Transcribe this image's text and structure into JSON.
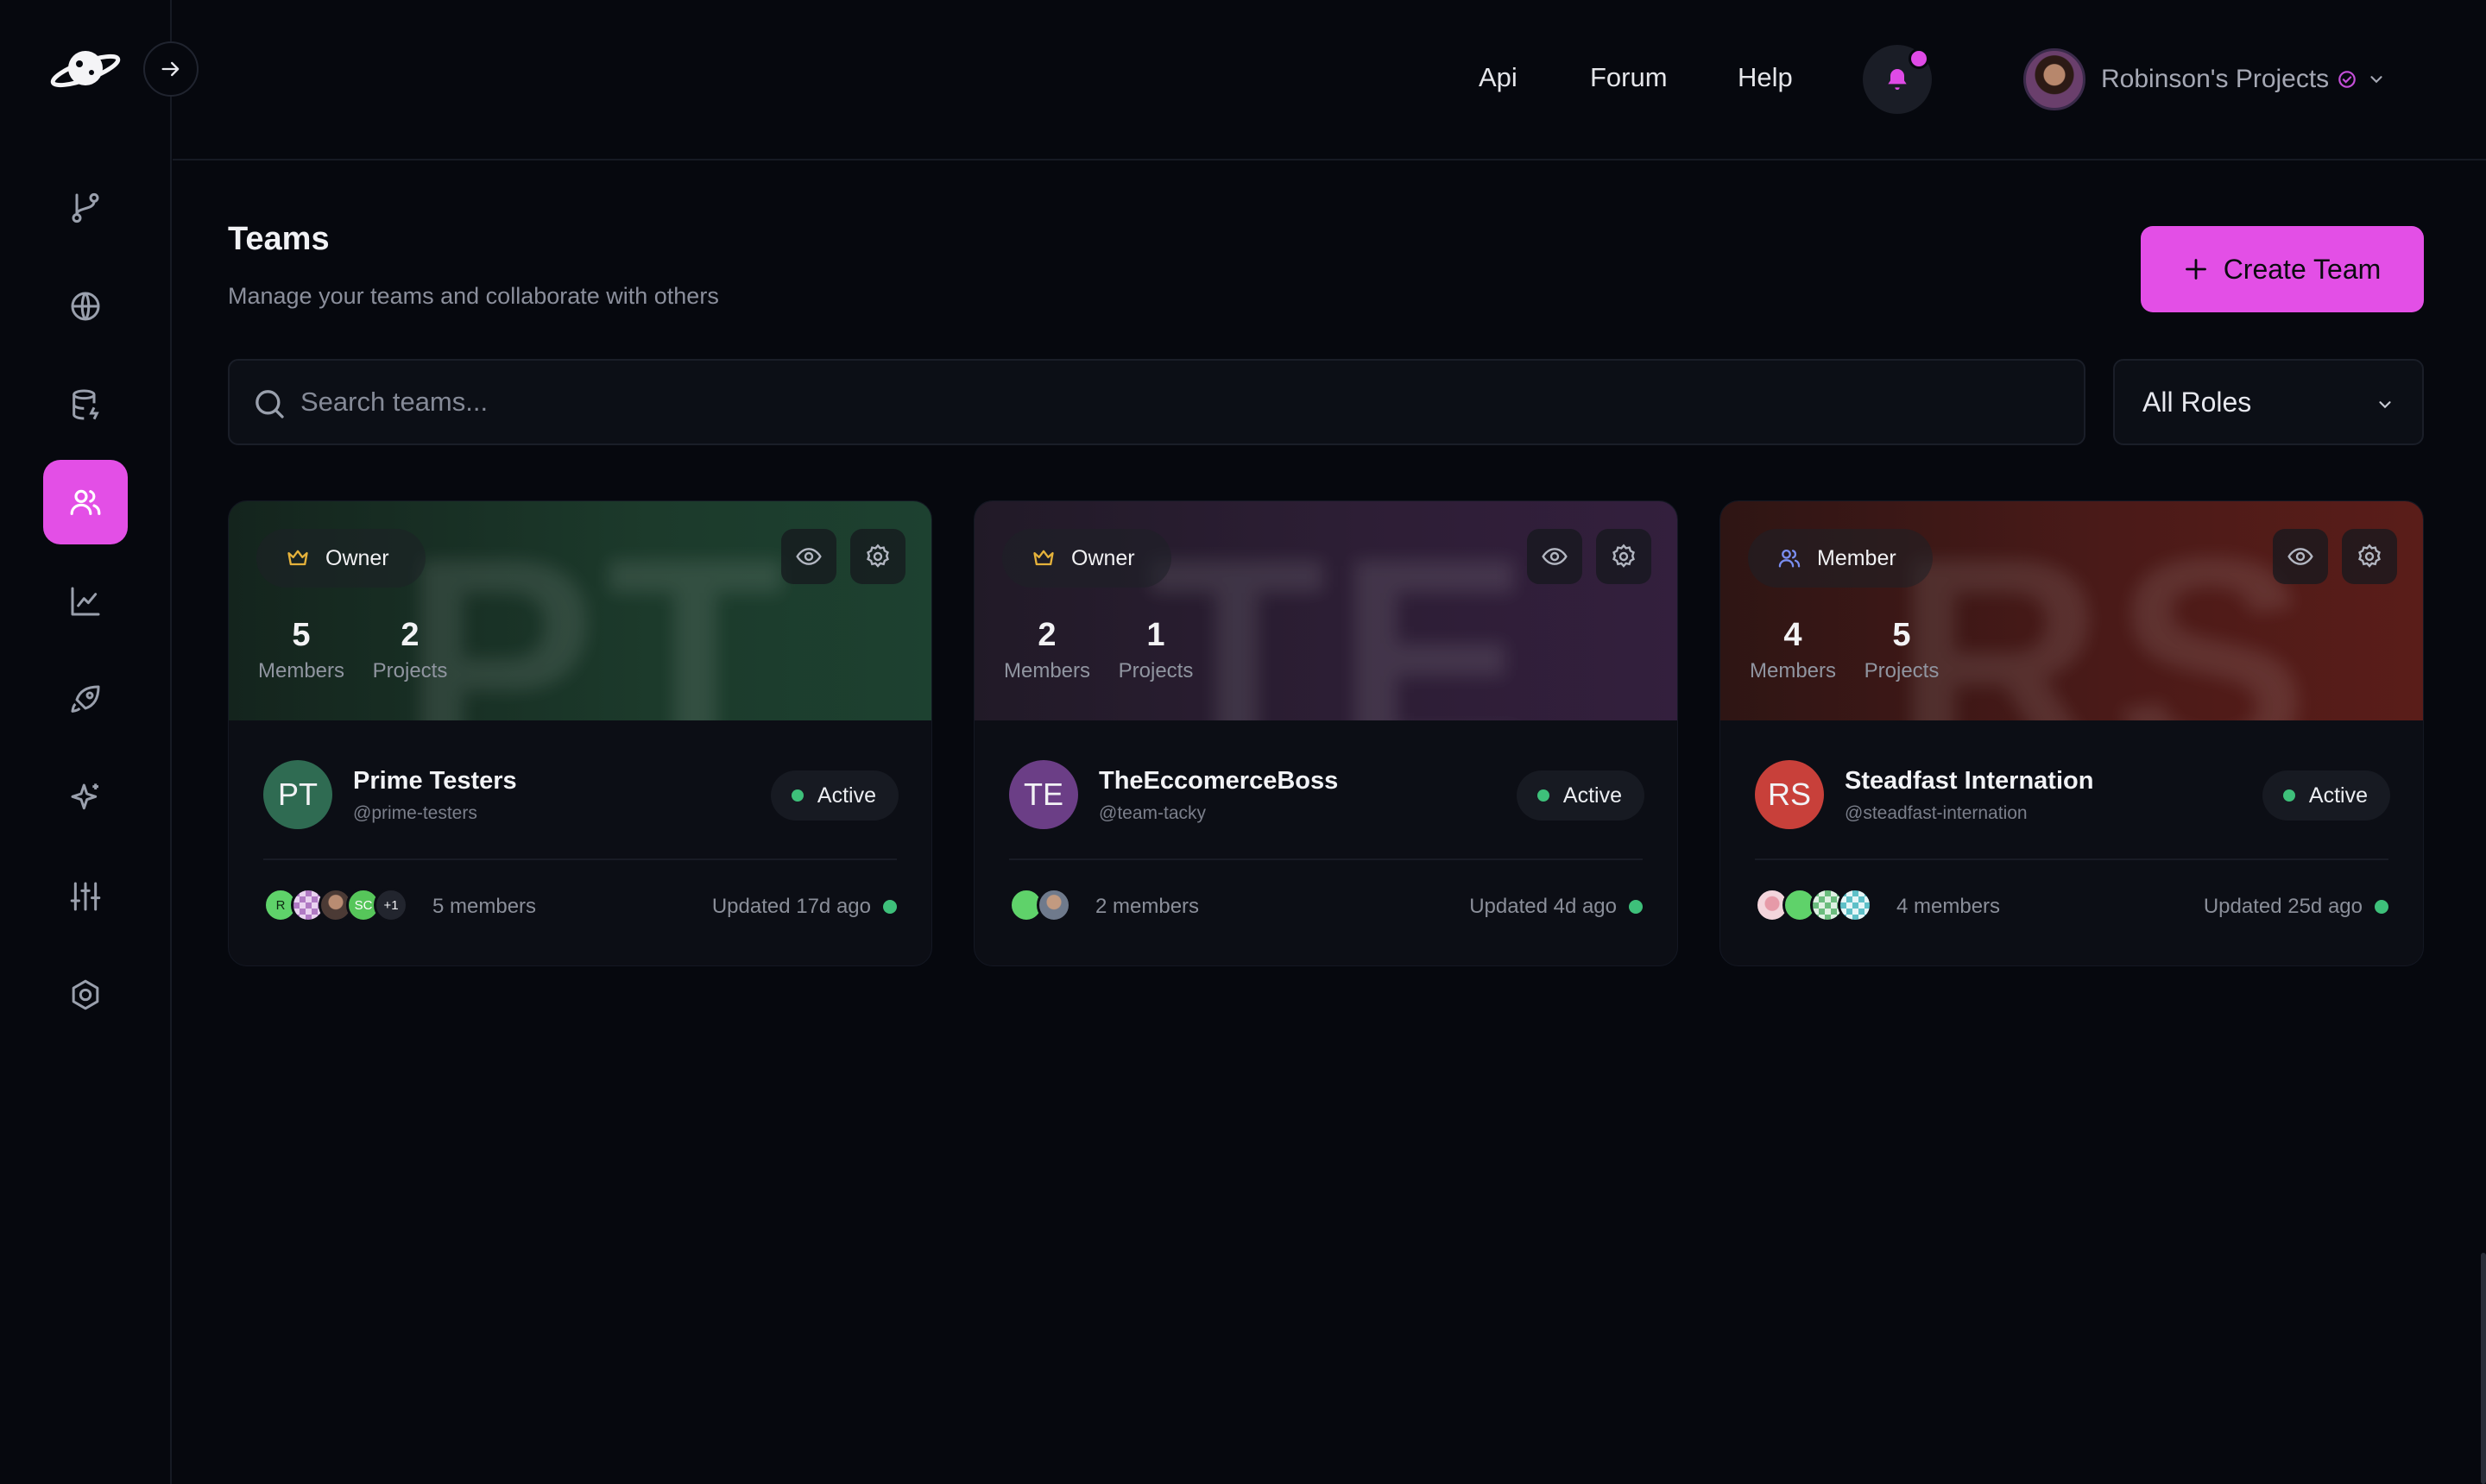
{
  "colors": {
    "accent": "#e34fe6",
    "active": "#3ec07a"
  },
  "header": {
    "links": [
      "Api",
      "Forum",
      "Help"
    ],
    "account_name": "Robinson's Projects"
  },
  "sidebar": {
    "items": [
      "git-branch-icon",
      "globe-icon",
      "database-icon",
      "users-icon",
      "chart-icon",
      "rocket-icon",
      "sparkle-icon",
      "sliders-icon",
      "hexagon-icon"
    ],
    "active": "users-icon"
  },
  "page": {
    "title": "Teams",
    "subtitle": "Manage your teams and collaborate with others",
    "create_label": "Create Team",
    "search_placeholder": "Search teams...",
    "role_filter": "All Roles"
  },
  "teams": [
    {
      "initials": "PT",
      "role": "Owner",
      "members": "5",
      "projects": "2",
      "members_label": "Members",
      "projects_label": "Projects",
      "name": "Prime Testers",
      "handle": "@prime-testers",
      "status": "Active",
      "member_summary": "5 members",
      "updated": "Updated 17d ago",
      "avatar_labels": [
        "R",
        "",
        "",
        "SC",
        "+1"
      ],
      "banner_color": "#1b3a2a",
      "avatar_color": "#2f6b52"
    },
    {
      "initials": "TE",
      "role": "Owner",
      "members": "2",
      "projects": "1",
      "members_label": "Members",
      "projects_label": "Projects",
      "name": "TheEccomerceBoss",
      "handle": "@team-tacky",
      "status": "Active",
      "member_summary": "2 members",
      "updated": "Updated 4d ago",
      "avatar_labels": [
        "",
        ""
      ],
      "banner_color": "#2e1e35",
      "avatar_color": "#6b3e86"
    },
    {
      "initials": "RS",
      "role": "Member",
      "members": "4",
      "projects": "5",
      "members_label": "Members",
      "projects_label": "Projects",
      "name": "Steadfast Internation",
      "handle": "@steadfast-internation",
      "status": "Active",
      "member_summary": "4 members",
      "updated": "Updated 25d ago",
      "avatar_labels": [
        "",
        "",
        "",
        ""
      ],
      "banner_color": "#4a1a18",
      "avatar_color": "#c8403a"
    }
  ]
}
